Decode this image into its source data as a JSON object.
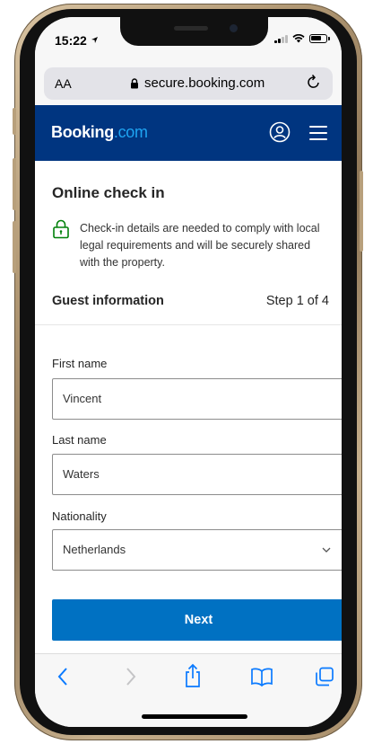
{
  "status": {
    "time": "15:22"
  },
  "browser": {
    "text_size": "AA",
    "url": "secure.booking.com"
  },
  "header": {
    "logo_main": "Booking",
    "logo_suffix": ".com"
  },
  "page": {
    "title": "Online check in",
    "notice": "Check-in details are needed to comply with local legal requirements and will be securely shared with the property."
  },
  "section": {
    "title": "Guest information",
    "step": "Step 1 of 4"
  },
  "form": {
    "first_name": {
      "label": "First name",
      "value": "Vincent"
    },
    "last_name": {
      "label": "Last name",
      "value": "Waters"
    },
    "nationality": {
      "label": "Nationality",
      "value": "Netherlands"
    },
    "next_label": "Next"
  },
  "toolbar": {
    "icons": [
      "back-icon",
      "forward-icon",
      "share-icon",
      "bookmarks-icon",
      "tabs-icon"
    ]
  },
  "colors": {
    "brand_navy": "#003580",
    "brand_com": "#1ea4f2",
    "button_blue": "#0071c2",
    "ios_blue": "#0a7aff",
    "lock_green": "#008009"
  }
}
